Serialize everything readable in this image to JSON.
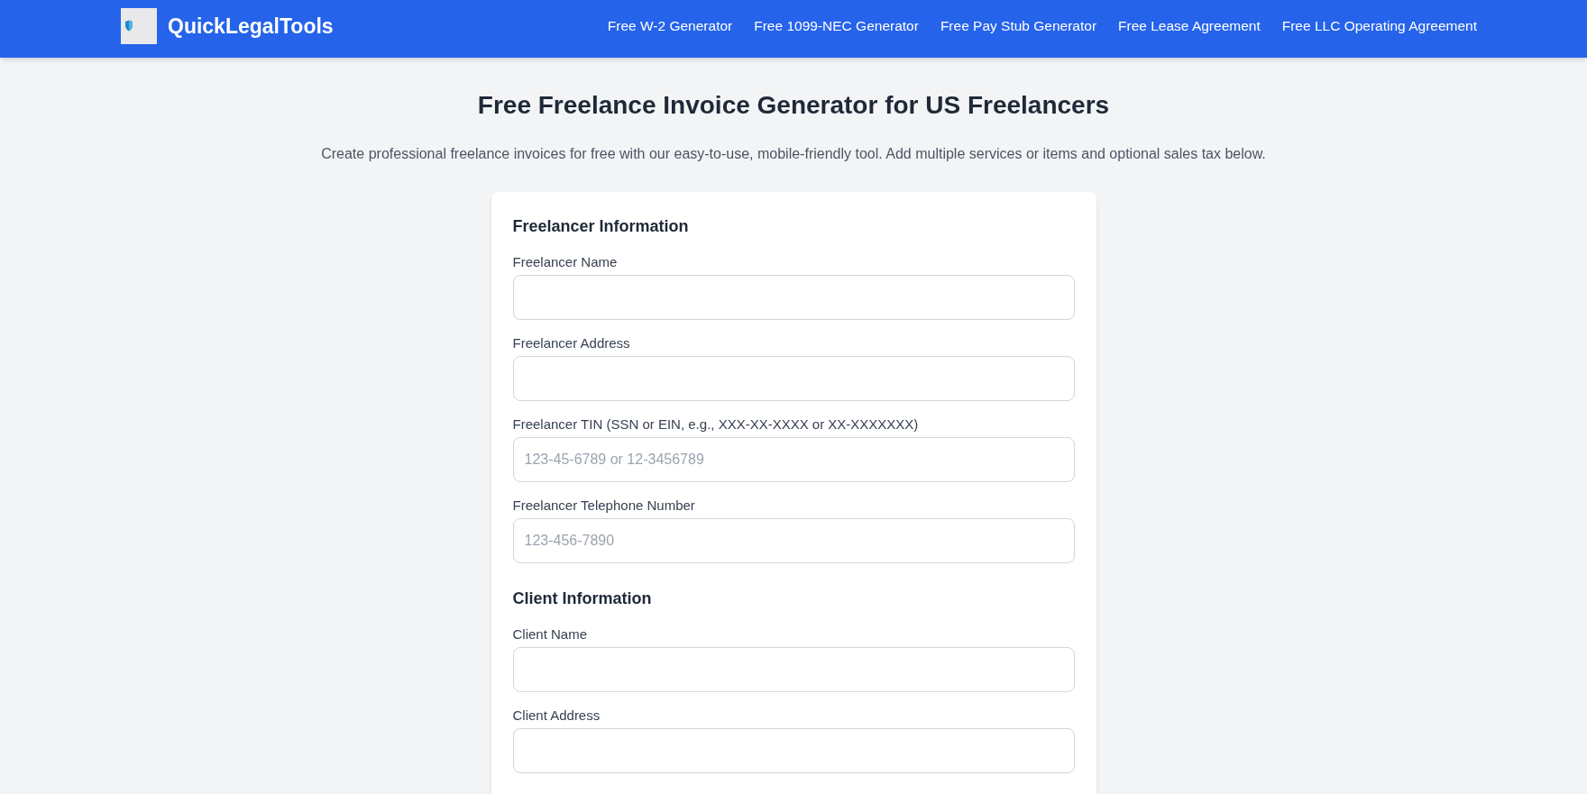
{
  "header": {
    "brand": "QuickLegalTools",
    "nav_links": [
      "Free W-2 Generator",
      "Free 1099-NEC Generator",
      "Free Pay Stub Generator",
      "Free Lease Agreement",
      "Free LLC Operating Agreement"
    ]
  },
  "page": {
    "title": "Free Freelance Invoice Generator for US Freelancers",
    "description": "Create professional freelance invoices for free with our easy-to-use, mobile-friendly tool. Add multiple services or items and optional sales tax below."
  },
  "form": {
    "sections": [
      {
        "heading": "Freelancer Information",
        "fields": [
          {
            "label": "Freelancer Name"
          },
          {
            "label": "Freelancer Address"
          },
          {
            "label": "Freelancer TIN (SSN or EIN, e.g., XXX-XX-XXXX or XX-XXXXXXX)",
            "placeholder": "123-45-6789 or 12-3456789"
          },
          {
            "label": "Freelancer Telephone Number",
            "placeholder": "123-456-7890"
          }
        ]
      },
      {
        "heading": "Client Information",
        "fields": [
          {
            "label": "Client Name"
          },
          {
            "label": "Client Address"
          }
        ]
      }
    ]
  }
}
